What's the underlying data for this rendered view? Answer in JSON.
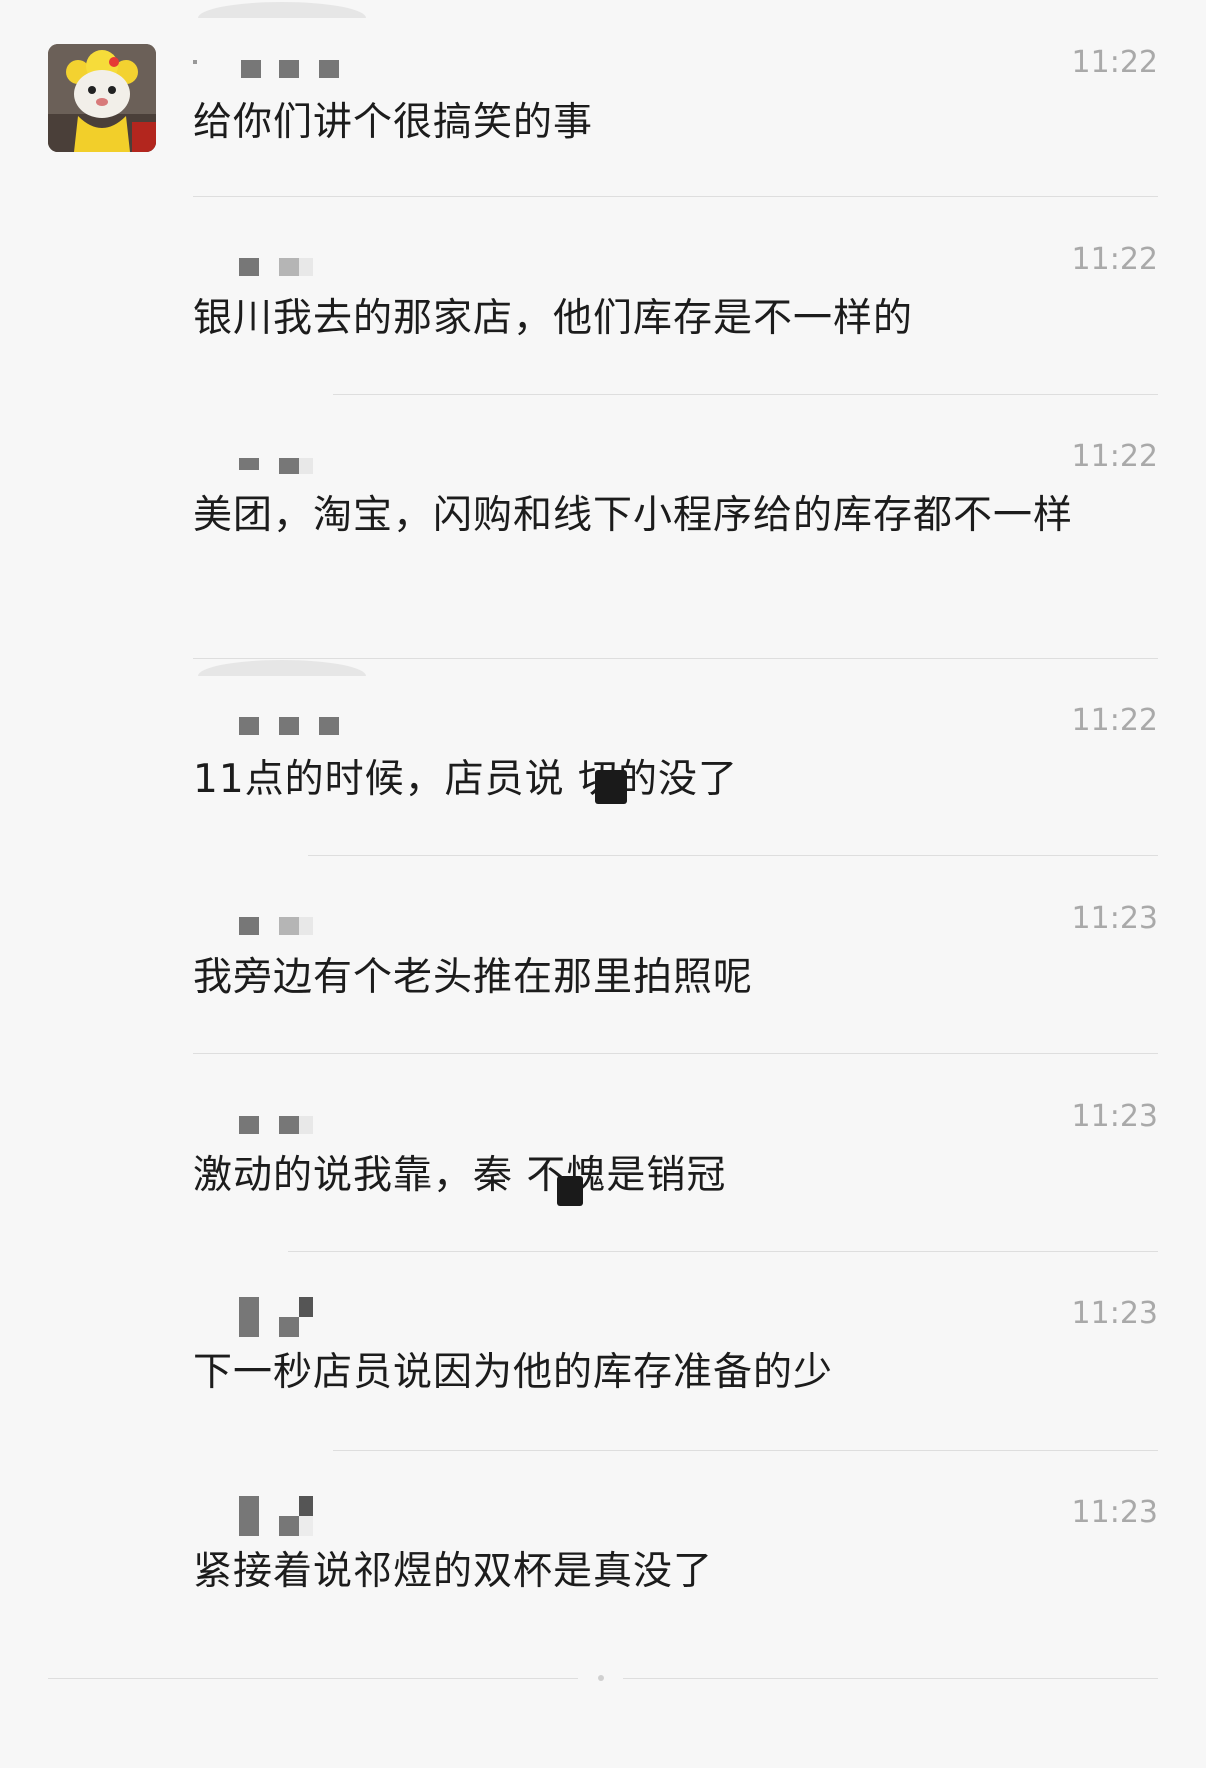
{
  "messages": [
    {
      "sender": "",
      "time": "11:22",
      "text": "给你们讲个很搞笑的事"
    },
    {
      "sender": "",
      "time": "11:22",
      "text": "银川我去的那家店，他们库存是不一样的"
    },
    {
      "sender": "",
      "time": "11:22",
      "text": "美团，淘宝，闪购和线下小程序给的库存都不一样"
    },
    {
      "sender": "",
      "time": "11:22",
      "text": "11点的时候，店员说  切的没了"
    },
    {
      "sender": "",
      "time": "11:23",
      "text": "我旁边有个老头推在那里拍照呢"
    },
    {
      "sender": "",
      "time": "11:23",
      "text": "激动的说我靠，秦  不愧是销冠"
    },
    {
      "sender": "",
      "time": "11:23",
      "text": "下一秒店员说因为他的库存准备的少"
    },
    {
      "sender": "",
      "time": "11:23",
      "text": "紧接着说祁煜的双杯是真没了"
    }
  ],
  "avatar": {
    "icon": "cartoon-cat-avatar"
  },
  "colors": {
    "background": "#f7f7f7",
    "text": "#1c1c1c",
    "time": "#a9a9a9",
    "divider": "#dedede"
  }
}
